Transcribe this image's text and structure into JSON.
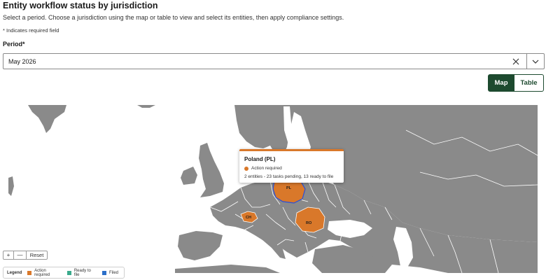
{
  "header": {
    "title": "Entity workflow status by jurisdiction",
    "subtitle": "Select a period. Choose a jurisdiction using the map or table to view and select its entities, then apply compliance settings.",
    "required_note": "* Indicates required field"
  },
  "period": {
    "label": "Period*",
    "value": "May 2026"
  },
  "view_toggle": {
    "map_label": "Map",
    "table_label": "Table",
    "selected": "Map"
  },
  "map": {
    "countries": [
      {
        "code": "PL",
        "status": "Action required"
      },
      {
        "code": "CH",
        "status": "Action required"
      },
      {
        "code": "RO",
        "status": "Action required"
      }
    ],
    "tooltip": {
      "title": "Poland (PL)",
      "status": "Action required",
      "detail": "2 entities - 23 tasks pending, 13 ready to file"
    },
    "controls": {
      "zoom_in": "+",
      "zoom_out": "—",
      "reset": "Reset"
    }
  },
  "legend": {
    "title": "Legend",
    "items": [
      {
        "label": "Action required",
        "color": "#d9782a"
      },
      {
        "label": "Ready to file",
        "color": "#3aaa8c"
      },
      {
        "label": "Filed",
        "color": "#2b6fc9"
      }
    ]
  },
  "colors": {
    "land": "#8a8a8a",
    "action_required": "#d9782a",
    "brand_green": "#1d4a2f",
    "selected_outline": "#2b4fd8"
  }
}
